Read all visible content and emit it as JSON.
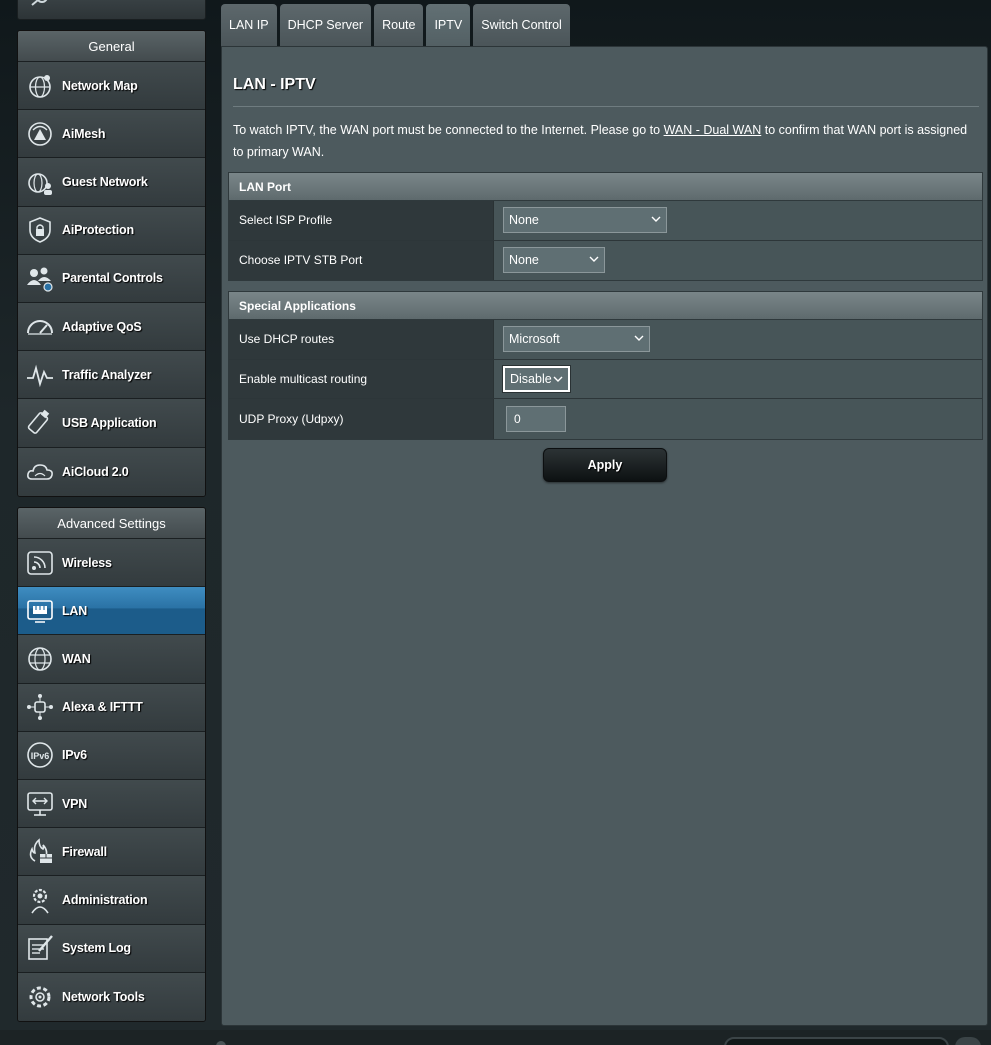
{
  "sidebar": {
    "general": {
      "header": "General",
      "items": [
        {
          "label": "Network Map",
          "icon": "network-map-icon"
        },
        {
          "label": "AiMesh",
          "icon": "aimesh-icon"
        },
        {
          "label": "Guest Network",
          "icon": "guest-network-icon"
        },
        {
          "label": "AiProtection",
          "icon": "aiprotection-icon"
        },
        {
          "label": "Parental Controls",
          "icon": "parental-controls-icon"
        },
        {
          "label": "Adaptive QoS",
          "icon": "adaptive-qos-icon"
        },
        {
          "label": "Traffic Analyzer",
          "icon": "traffic-analyzer-icon"
        },
        {
          "label": "USB Application",
          "icon": "usb-application-icon"
        },
        {
          "label": "AiCloud 2.0",
          "icon": "aicloud-icon"
        }
      ]
    },
    "advanced": {
      "header": "Advanced Settings",
      "items": [
        {
          "label": "Wireless",
          "icon": "wireless-icon"
        },
        {
          "label": "LAN",
          "icon": "lan-icon",
          "active": true
        },
        {
          "label": "WAN",
          "icon": "wan-icon"
        },
        {
          "label": "Alexa & IFTTT",
          "icon": "alexa-ifttt-icon"
        },
        {
          "label": "IPv6",
          "icon": "ipv6-icon"
        },
        {
          "label": "VPN",
          "icon": "vpn-icon"
        },
        {
          "label": "Firewall",
          "icon": "firewall-icon"
        },
        {
          "label": "Administration",
          "icon": "administration-icon"
        },
        {
          "label": "System Log",
          "icon": "system-log-icon"
        },
        {
          "label": "Network Tools",
          "icon": "network-tools-icon"
        }
      ]
    }
  },
  "tabs": [
    {
      "label": "LAN IP"
    },
    {
      "label": "DHCP Server"
    },
    {
      "label": "Route"
    },
    {
      "label": "IPTV",
      "active": true
    },
    {
      "label": "Switch Control"
    }
  ],
  "main": {
    "title": "LAN - IPTV",
    "description_before": "To watch IPTV, the WAN port must be connected to the Internet. Please go to ",
    "description_link": "WAN - Dual WAN",
    "description_after": " to confirm that WAN port is assigned to primary WAN.",
    "lan_port": {
      "header": "LAN Port",
      "isp_profile_label": "Select ISP Profile",
      "isp_profile_value": "None",
      "stb_port_label": "Choose IPTV STB Port",
      "stb_port_value": "None"
    },
    "special_apps": {
      "header": "Special Applications",
      "dhcp_routes_label": "Use DHCP routes",
      "dhcp_routes_value": "Microsoft",
      "multicast_label": "Enable multicast routing",
      "multicast_value": "Disable",
      "udpxy_label": "UDP Proxy (Udpxy)",
      "udpxy_value": "0"
    },
    "apply_label": "Apply"
  },
  "colors": {
    "active_item": "#2a72a5",
    "panel_bg": "#4d5a5e",
    "label_bg": "#2f383b"
  }
}
